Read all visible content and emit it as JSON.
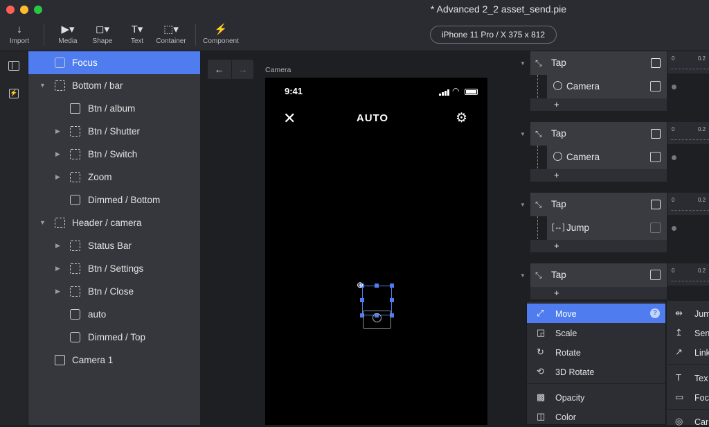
{
  "window": {
    "title": "* Advanced 2_2 asset_send.pie"
  },
  "toolbar": {
    "import": "Import",
    "media": "Media",
    "shape": "Shape",
    "text": "Text",
    "container": "Container",
    "component": "Component",
    "device": "iPhone 11 Pro / X  375 x 812"
  },
  "layers": [
    {
      "label": "Focus"
    },
    {
      "label": "Bottom / bar"
    },
    {
      "label": "Btn / album"
    },
    {
      "label": "Btn / Shutter"
    },
    {
      "label": "Btn / Switch"
    },
    {
      "label": "Zoom"
    },
    {
      "label": "Dimmed / Bottom"
    },
    {
      "label": "Header / camera"
    },
    {
      "label": "Status Bar"
    },
    {
      "label": "Btn / Settings"
    },
    {
      "label": "Btn / Close"
    },
    {
      "label": "auto"
    },
    {
      "label": "Dimmed / Top"
    },
    {
      "label": "Camera 1"
    }
  ],
  "canvas": {
    "scene_label": "Camera",
    "time": "9:41",
    "mode": "AUTO"
  },
  "interactions": {
    "tap_label": "Tap",
    "target1": "Camera",
    "target2": "Camera",
    "target3": "Jump",
    "ruler0": "0",
    "ruler1": "0.2",
    "add": "+"
  },
  "menu": {
    "move": "Move",
    "scale": "Scale",
    "rotate": "Rotate",
    "rotate3d": "3D Rotate",
    "opacity": "Opacity",
    "color": "Color",
    "help": "?"
  },
  "menu2": {
    "jump": "Jum",
    "send": "Sen",
    "link": "Link",
    "text": "Tex",
    "focus": "Foc",
    "camera": "Car"
  },
  "colors": {
    "accent": "#4f7df0"
  }
}
